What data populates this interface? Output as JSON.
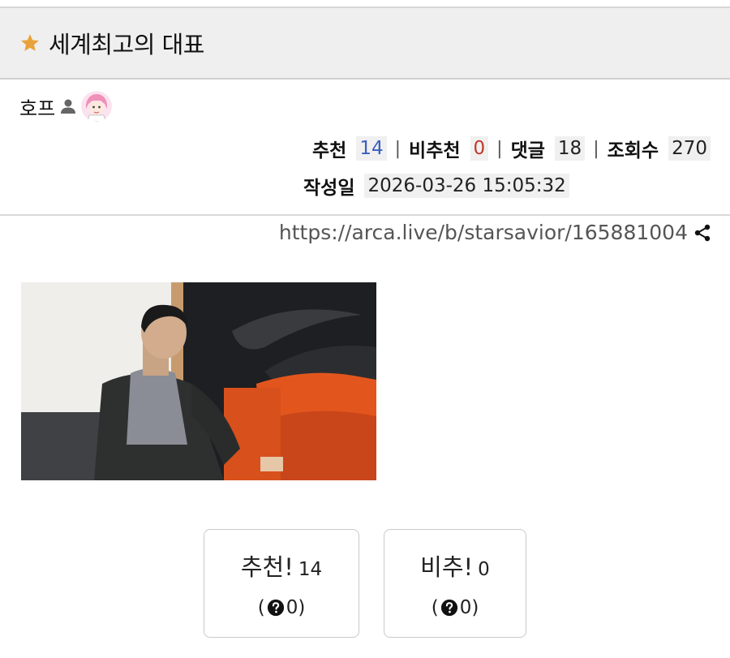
{
  "post": {
    "title": "세계최고의 대표",
    "author": "호프",
    "url": "https://arca.live/b/starsavior/165881004"
  },
  "stats": {
    "recommend_label": "추천",
    "recommend_value": "14",
    "downvote_label": "비추천",
    "downvote_value": "0",
    "comments_label": "댓글",
    "comments_value": "18",
    "views_label": "조회수",
    "views_value": "270",
    "separator": "|",
    "date_label": "작성일",
    "date_value": "2026-03-26 15:05:32"
  },
  "votes": {
    "up_label": "추천!",
    "up_count": "14",
    "up_open": "(",
    "up_sub": "0)",
    "down_label": "비추!",
    "down_count": "0",
    "down_open": "(",
    "down_sub": "0)"
  },
  "icons": {
    "title": "star-icon",
    "author": "person-icon",
    "share": "share-icon",
    "help": "question-circle-icon"
  },
  "colors": {
    "star": "#e9a23b",
    "recommend_value": "#3b5fc0",
    "downvote_value": "#c0392b",
    "title_bar_bg": "#efefef"
  }
}
